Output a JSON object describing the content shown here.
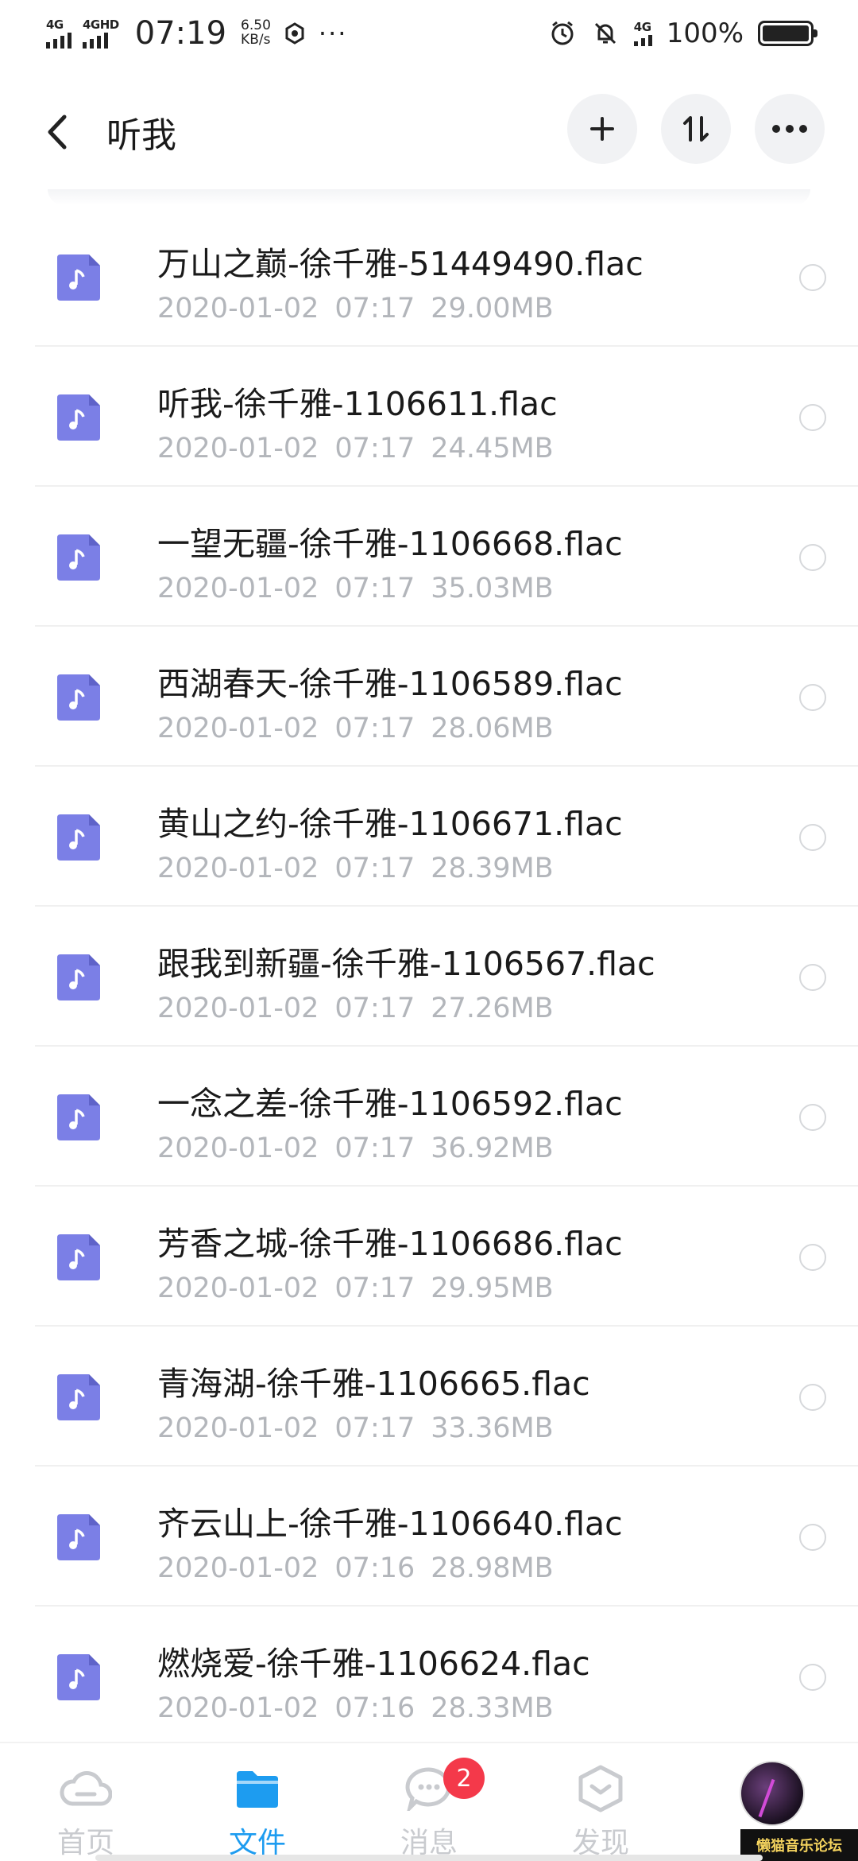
{
  "status_bar": {
    "net1": "4G",
    "net2": "4GHD",
    "time": "07:19",
    "speed_value": "6.50",
    "speed_unit": "KB/s",
    "more": "···",
    "net3": "4G",
    "battery": "100%",
    "battery_level": 1.0
  },
  "header": {
    "title": "听我"
  },
  "files": [
    {
      "name": "万山之巅-徐千雅-51449490.flac",
      "date": "2020-01-02",
      "time": "07:17",
      "size": "29.00MB"
    },
    {
      "name": "听我-徐千雅-1106611.flac",
      "date": "2020-01-02",
      "time": "07:17",
      "size": "24.45MB"
    },
    {
      "name": "一望无疆-徐千雅-1106668.flac",
      "date": "2020-01-02",
      "time": "07:17",
      "size": "35.03MB"
    },
    {
      "name": "西湖春天-徐千雅-1106589.flac",
      "date": "2020-01-02",
      "time": "07:17",
      "size": "28.06MB"
    },
    {
      "name": "黄山之约-徐千雅-1106671.flac",
      "date": "2020-01-02",
      "time": "07:17",
      "size": "28.39MB"
    },
    {
      "name": "跟我到新疆-徐千雅-1106567.flac",
      "date": "2020-01-02",
      "time": "07:17",
      "size": "27.26MB"
    },
    {
      "name": "一念之差-徐千雅-1106592.flac",
      "date": "2020-01-02",
      "time": "07:17",
      "size": "36.92MB"
    },
    {
      "name": "芳香之城-徐千雅-1106686.flac",
      "date": "2020-01-02",
      "time": "07:17",
      "size": "29.95MB"
    },
    {
      "name": "青海湖-徐千雅-1106665.flac",
      "date": "2020-01-02",
      "time": "07:17",
      "size": "33.36MB"
    },
    {
      "name": "齐云山上-徐千雅-1106640.flac",
      "date": "2020-01-02",
      "time": "07:16",
      "size": "28.98MB"
    },
    {
      "name": "燃烧爱-徐千雅-1106624.flac",
      "date": "2020-01-02",
      "time": "07:16",
      "size": "28.33MB"
    }
  ],
  "nav": {
    "home": "首页",
    "files": "文件",
    "messages": "消息",
    "messages_badge": "2",
    "discover": "发现"
  },
  "watermark": "懒猫音乐论坛",
  "colors": {
    "accent": "#1d9cf0",
    "file_icon": "#7b7fe6",
    "badge": "#f4394a",
    "secondary_text": "#b3b6bb"
  }
}
